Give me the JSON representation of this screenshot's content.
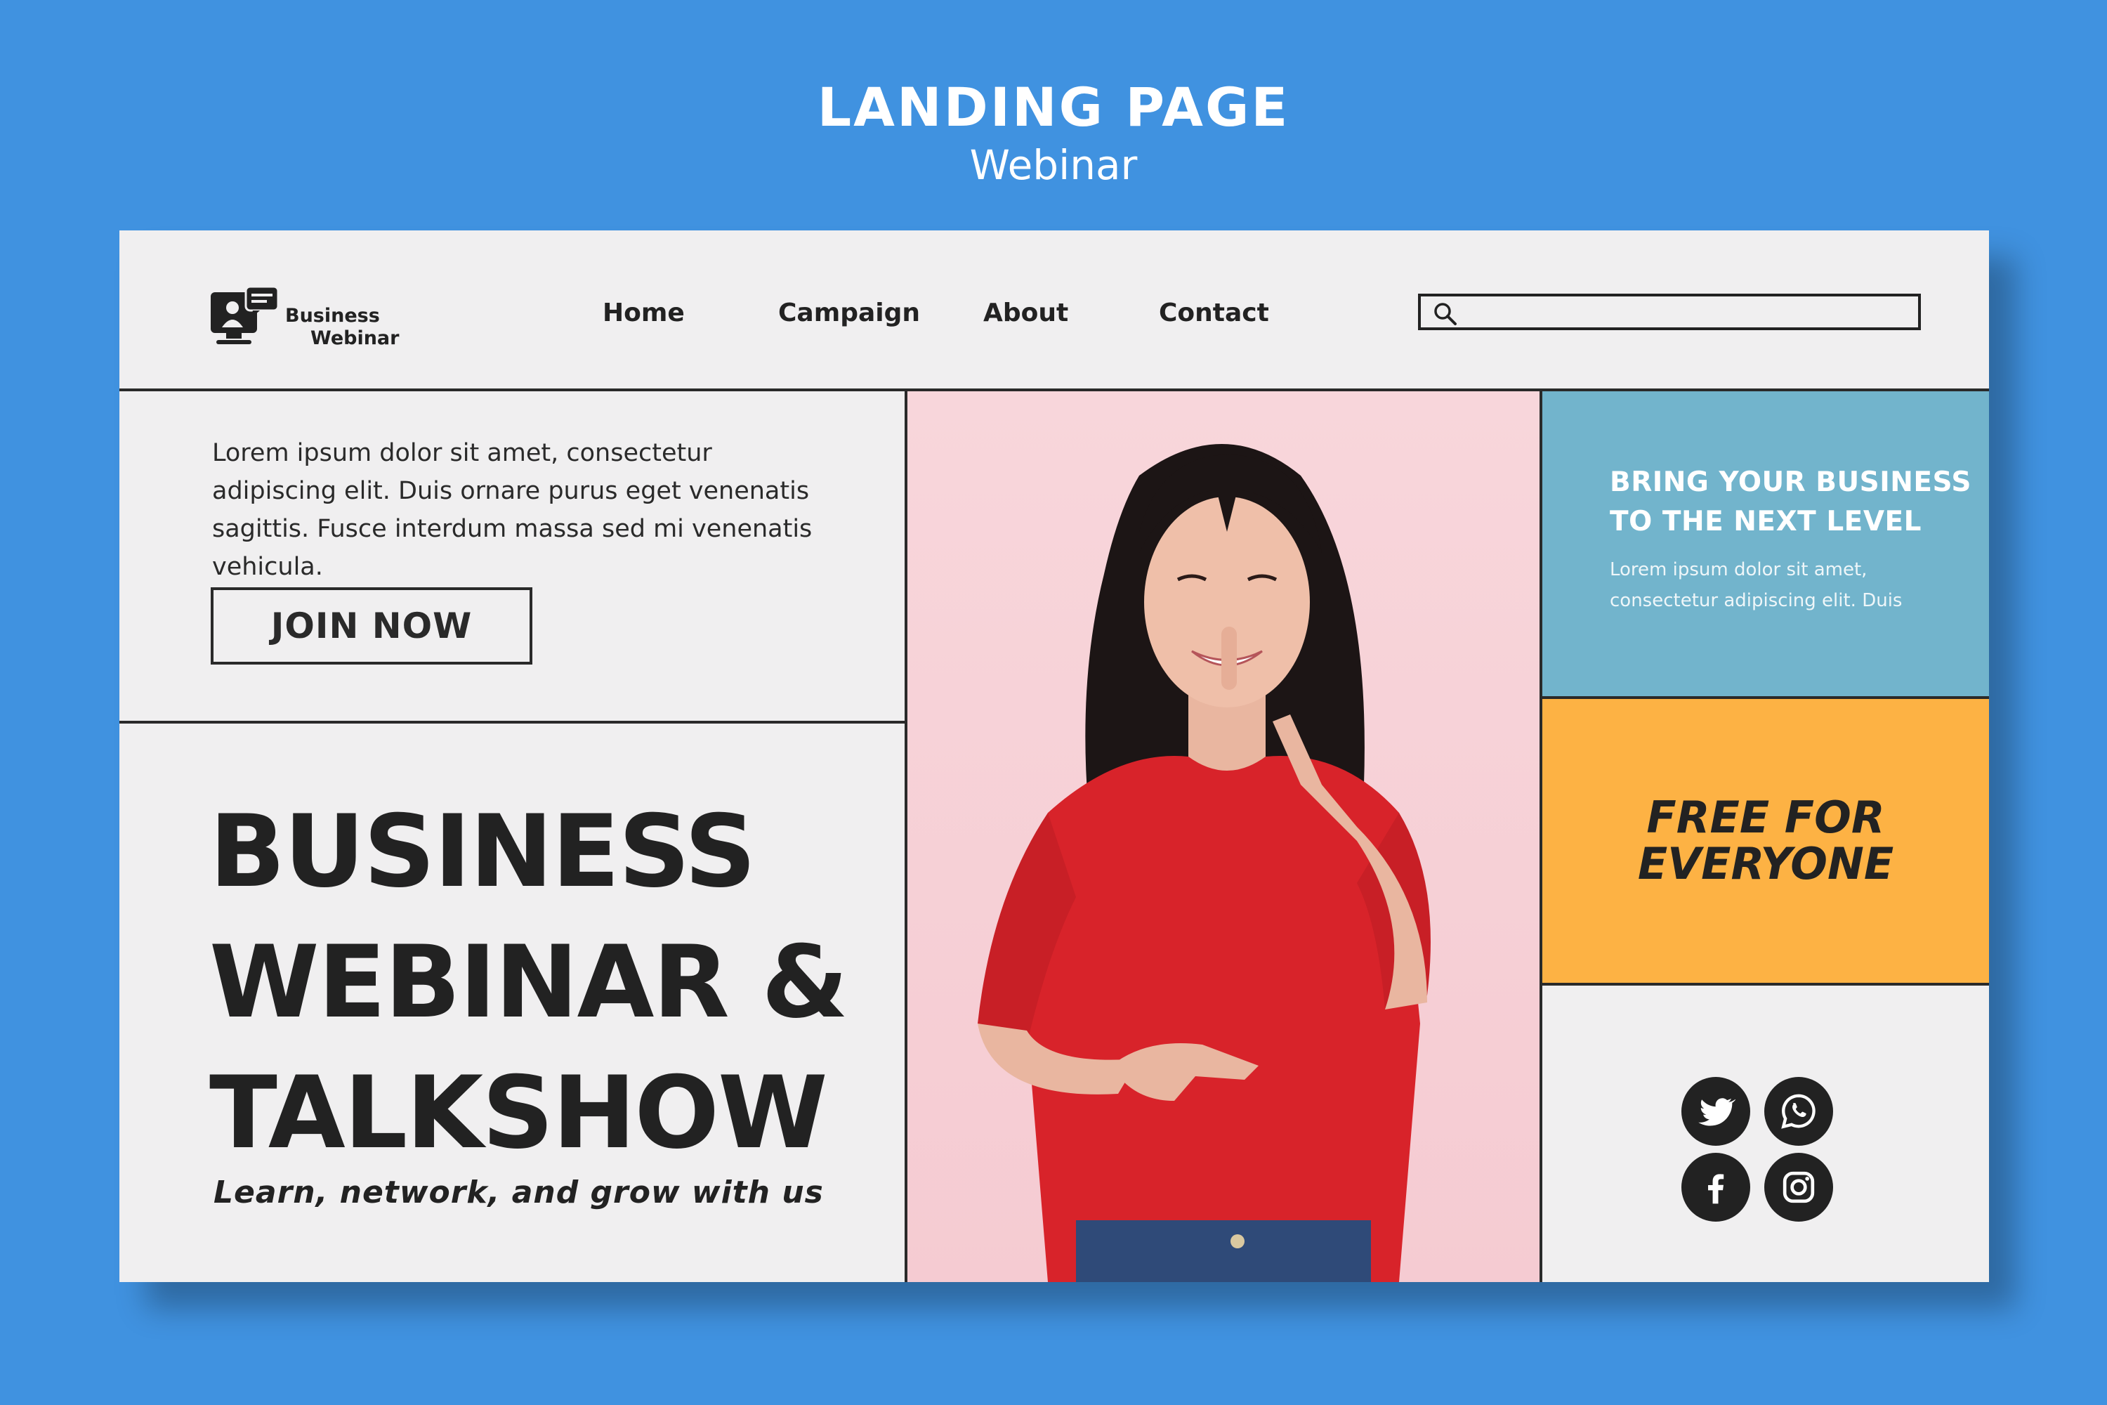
{
  "header": {
    "title": "LANDING PAGE",
    "subtitle": "Webinar"
  },
  "logo": {
    "line1": "Business",
    "line2": "Webinar"
  },
  "nav": {
    "items": [
      "Home",
      "Campaign",
      "About",
      "Contact"
    ]
  },
  "search": {
    "placeholder": "",
    "value": ""
  },
  "intro": {
    "text": "Lorem ipsum dolor sit amet, consectetur adipiscing elit. Duis ornare purus eget venenatis sagittis. Fusce interdum massa sed mi venenatis vehicula."
  },
  "cta": {
    "join_label": "JOIN NOW"
  },
  "hero": {
    "title_line1": "BUSINESS",
    "title_line2": "WEBINAR &",
    "title_line3": "TALKSHOW",
    "tagline": "Learn, network, and grow with us"
  },
  "promo": {
    "title": "BRING YOUR BUSINESS TO THE NEXT LEVEL",
    "body": "Lorem ipsum dolor sit amet, consectetur adipiscing elit. Duis"
  },
  "free": {
    "line1": "FREE FOR",
    "line2": "EVERYONE"
  },
  "social": {
    "icons": [
      "twitter-icon",
      "whatsapp-icon",
      "facebook-icon",
      "instagram-icon"
    ]
  },
  "colors": {
    "background": "#4092e0",
    "panel": "#f0eff0",
    "blue_panel": "#72b4cc",
    "orange_panel": "#fdb244",
    "photo_bg": "#f5cbd2",
    "shirt": "#d8232a",
    "text_dark": "#222222"
  }
}
